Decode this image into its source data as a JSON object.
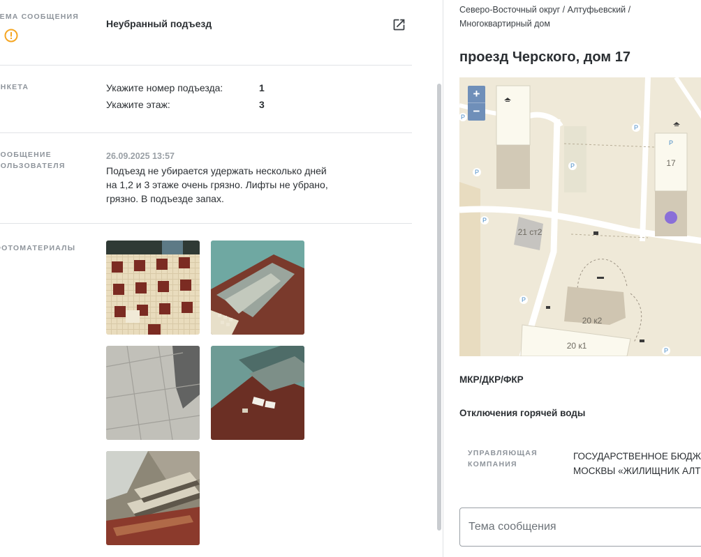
{
  "topic": {
    "label": "Тема сообщения",
    "title": "Неубранный подъезд",
    "warning_icon": "warning-circle-icon",
    "open_icon": "open-in-new-icon",
    "accent_color": "#f5a623"
  },
  "questionnaire": {
    "label": "Анкета",
    "rows": [
      {
        "question": "Укажите номер подъезда:",
        "answer": "1"
      },
      {
        "question": "Укажите этаж:",
        "answer": "3"
      }
    ]
  },
  "user_message": {
    "label_line1": "Сообщение",
    "label_line2": "пользователя",
    "date": "26.09.2025 13:57",
    "text": "Подъезд не убирается удержать несколько дней на 1,2 и 3 этаже очень грязно. Лифты не убрано, грязно. В подъезде запах."
  },
  "photos": {
    "label": "Фотоматериалы",
    "count": 5
  },
  "building": {
    "breadcrumb_line1": "Северо-Восточный округ / Алтуфьевский /",
    "breadcrumb_line2": "Многоквартирный дом",
    "address": "проезд Черского, дом 17"
  },
  "map": {
    "zoom_in": "+",
    "zoom_out": "−",
    "labels": {
      "b17": "17",
      "b21": "21 ст2",
      "b20k2": "20 к2",
      "b20k1": "20 к1",
      "parking": "P"
    },
    "marker_color": "#8a6fd8"
  },
  "sections": {
    "mkr": "МКР/ДКР/ФКР",
    "hot_water": "Отключения горячей воды"
  },
  "management": {
    "label_line1": "Управляющая",
    "label_line2": "компания",
    "value_line1": "ГОСУДАРСТВЕННОЕ БЮДЖЕ",
    "value_line2": "МОСКВЫ «ЖИЛИЩНИК АЛТУ"
  },
  "message_topic_input": {
    "placeholder": "Тема сообщения",
    "value": ""
  }
}
